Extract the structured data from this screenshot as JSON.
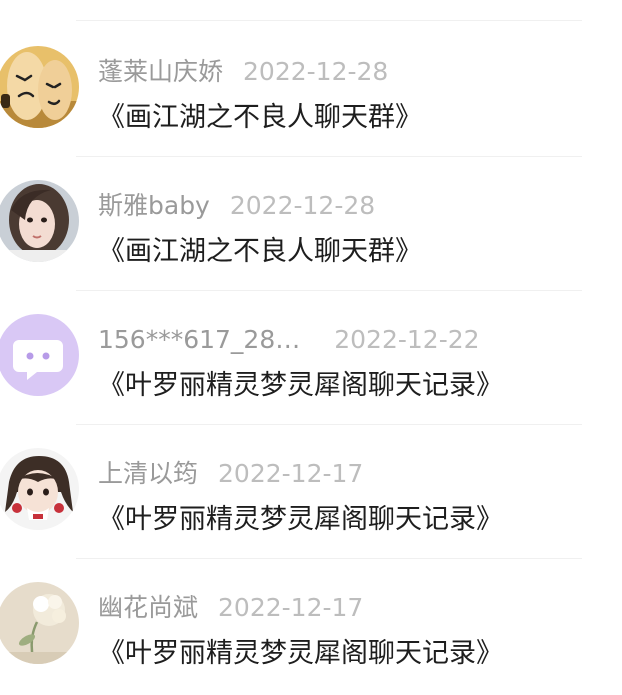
{
  "comments": [
    {
      "username": "蓬莱山庆娇",
      "date": "2022-12-28",
      "title": "《画江湖之不良人聊天群》",
      "avatar_icon": "finger-face-photo-icon"
    },
    {
      "username": "斯雅baby",
      "date": "2022-12-28",
      "title": "《画江湖之不良人聊天群》",
      "avatar_icon": "girl-portrait-photo-icon"
    },
    {
      "username": "156***617_28…",
      "date": "2022-12-22",
      "title": "《叶罗丽精灵梦灵犀阁聊天记录》",
      "avatar_icon": "default-chat-bubble-avatar-icon"
    },
    {
      "username": "上清以筠",
      "date": "2022-12-17",
      "title": "《叶罗丽精灵梦灵犀阁聊天记录》",
      "avatar_icon": "anime-girl-avatar-icon"
    },
    {
      "username": "幽花尚斌",
      "date": "2022-12-17",
      "title": "《叶罗丽精灵梦灵犀阁聊天记录》",
      "avatar_icon": "flower-photo-avatar-icon"
    }
  ],
  "colors": {
    "username": "#9a9a9a",
    "date": "#bdbdbd",
    "title": "#1e1e1e",
    "divider": "#f0f0f0",
    "default_avatar_bg": "#d9c8f5"
  }
}
